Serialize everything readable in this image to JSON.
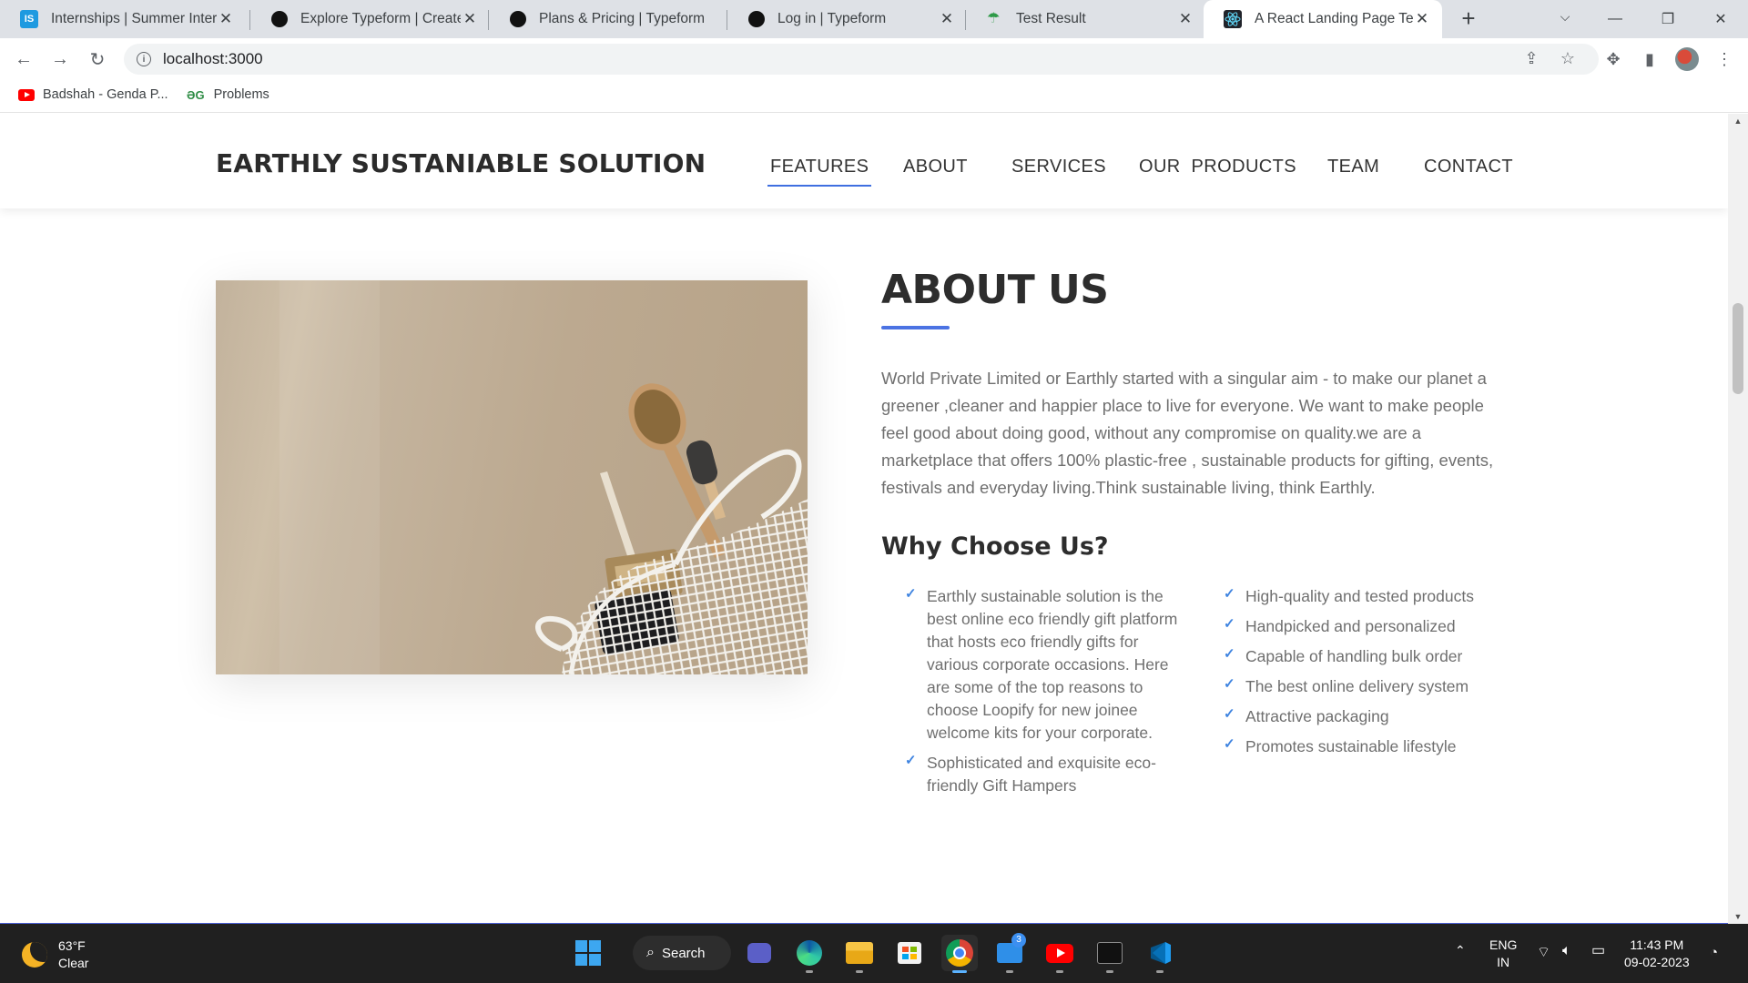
{
  "browser": {
    "tabs": [
      {
        "title": "Internships | Summer Internships",
        "favicon": "internshala-icon"
      },
      {
        "title": "Explore Typeform | Create your forms",
        "favicon": "typeform-icon"
      },
      {
        "title": "Plans & Pricing | Typeform",
        "favicon": "typeform-icon"
      },
      {
        "title": "Log in | Typeform",
        "favicon": "typeform-icon"
      },
      {
        "title": "Test Result",
        "favicon": "umbrella-icon"
      },
      {
        "title": "A React Landing Page Template",
        "favicon": "react-icon",
        "active": true
      }
    ],
    "url": "localhost:3000",
    "bookmarks": [
      {
        "label": "Badshah - Genda P...",
        "icon": "youtube-icon"
      },
      {
        "label": "Problems",
        "icon": "geeksforgeeks-icon"
      }
    ]
  },
  "site": {
    "brand": "EARTHLY SUSTANIABLE SOLUTION",
    "nav": [
      "FEATURES",
      "ABOUT",
      "SERVICES",
      "OUR  PRODUCTS",
      "TEAM",
      "CONTACT"
    ],
    "active_nav": "FEATURES",
    "accent_color": "#4b73e3"
  },
  "about": {
    "title": "ABOUT US",
    "text": "World Private Limited or Earthly started with a singular aim - to make our planet a greener ,cleaner and happier place to live for everyone. We want to make people feel good about doing good, without any compromise on quality.we are a marketplace that offers 100% plastic-free , sustainable products for gifting, events, festivals and everyday living.Think sustainable living, think Earthly.",
    "why_title": "Why Choose Us?",
    "reasons_left": [
      "Earthly sustainable solution is the best online eco friendly gift platform that hosts eco friendly gifts for various corporate occasions. Here are some of the top reasons to choose Loopify for new joinee welcome kits for your corporate.",
      "Sophisticated and exquisite eco-friendly Gift Hampers"
    ],
    "reasons_right": [
      "High-quality and tested products",
      "Handpicked and personalized",
      "Capable of handling bulk order",
      "The best online delivery system",
      "Attractive packaging",
      "Promotes sustainable lifestyle"
    ]
  },
  "taskbar": {
    "weather_temp": "63°F",
    "weather_desc": "Clear",
    "search_label": "Search",
    "mail_badge": "3",
    "lang_line1": "ENG",
    "lang_line2": "IN",
    "time": "11:43 PM",
    "date": "09-02-2023"
  }
}
